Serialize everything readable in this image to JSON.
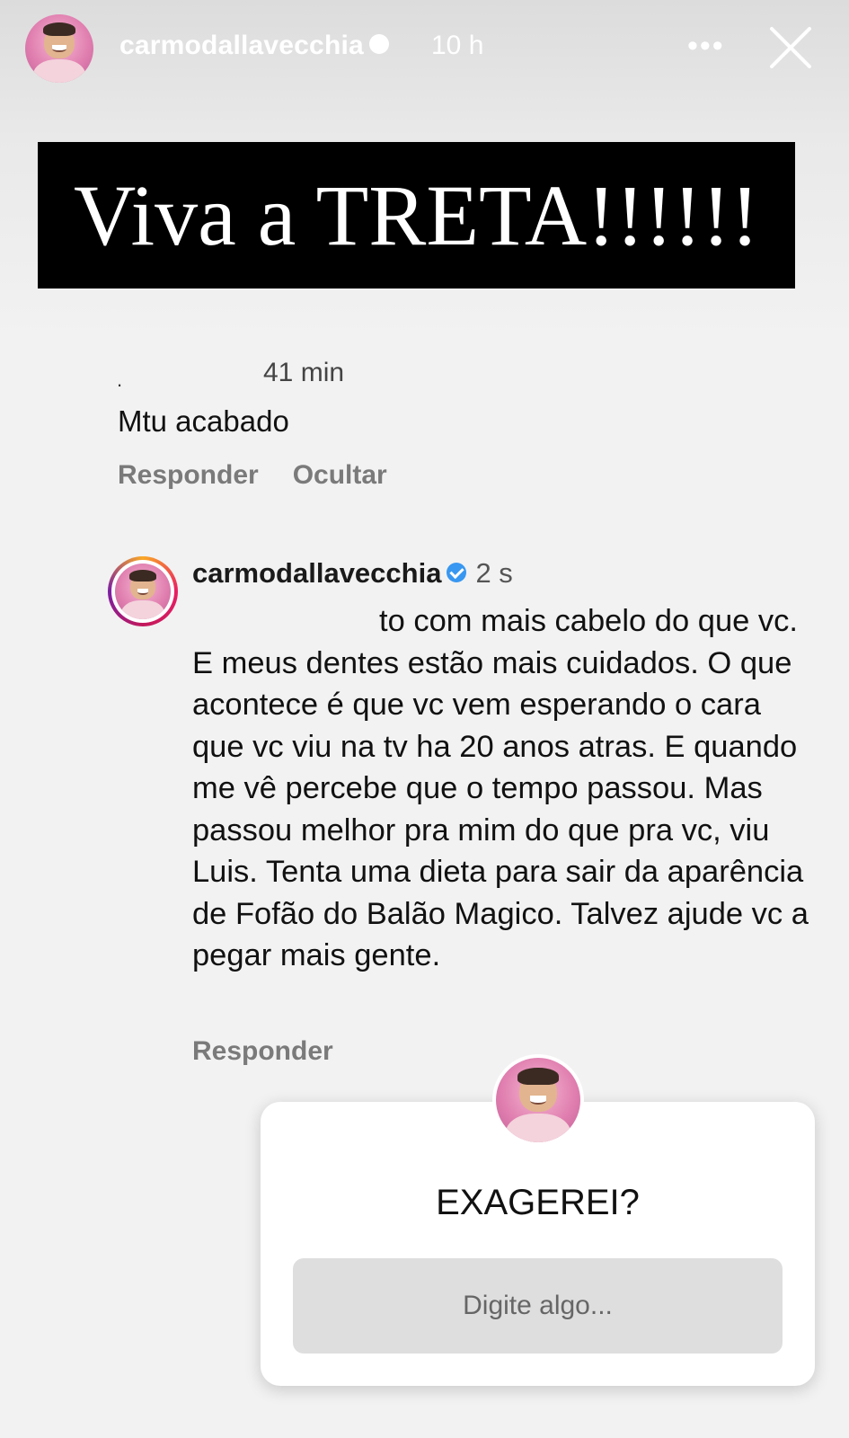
{
  "header": {
    "username": "carmodallavecchia",
    "time_ago": "10 h",
    "verified_color": "#ffffff"
  },
  "banner": {
    "text": "Viva a TRETA!!!!!!"
  },
  "comment_1": {
    "time": "41 min",
    "text": "Mtu acabado",
    "reply_label": "Responder",
    "hide_label": "Ocultar"
  },
  "comment_2": {
    "username": "carmodallavecchia",
    "time": "2 s",
    "text": "to com mais cabelo do que vc. E meus dentes estão mais cuidados. O que acontece é que vc vem esperando o cara que vc viu na tv ha 20 anos atras. E quando me vê percebe que o tempo passou. Mas passou melhor pra mim do que pra vc, viu Luis. Tenta uma dieta para sair da aparência de Fofão do Balão Magico. Talvez ajude vc a pegar mais gente.",
    "reply_label": "Responder",
    "verified_color": "#3897f0"
  },
  "question_sticker": {
    "question": "EXAGEREI?",
    "placeholder": "Digite algo..."
  },
  "icons": {
    "more": "more-icon",
    "close": "close-icon",
    "verified": "verified-badge-icon"
  }
}
